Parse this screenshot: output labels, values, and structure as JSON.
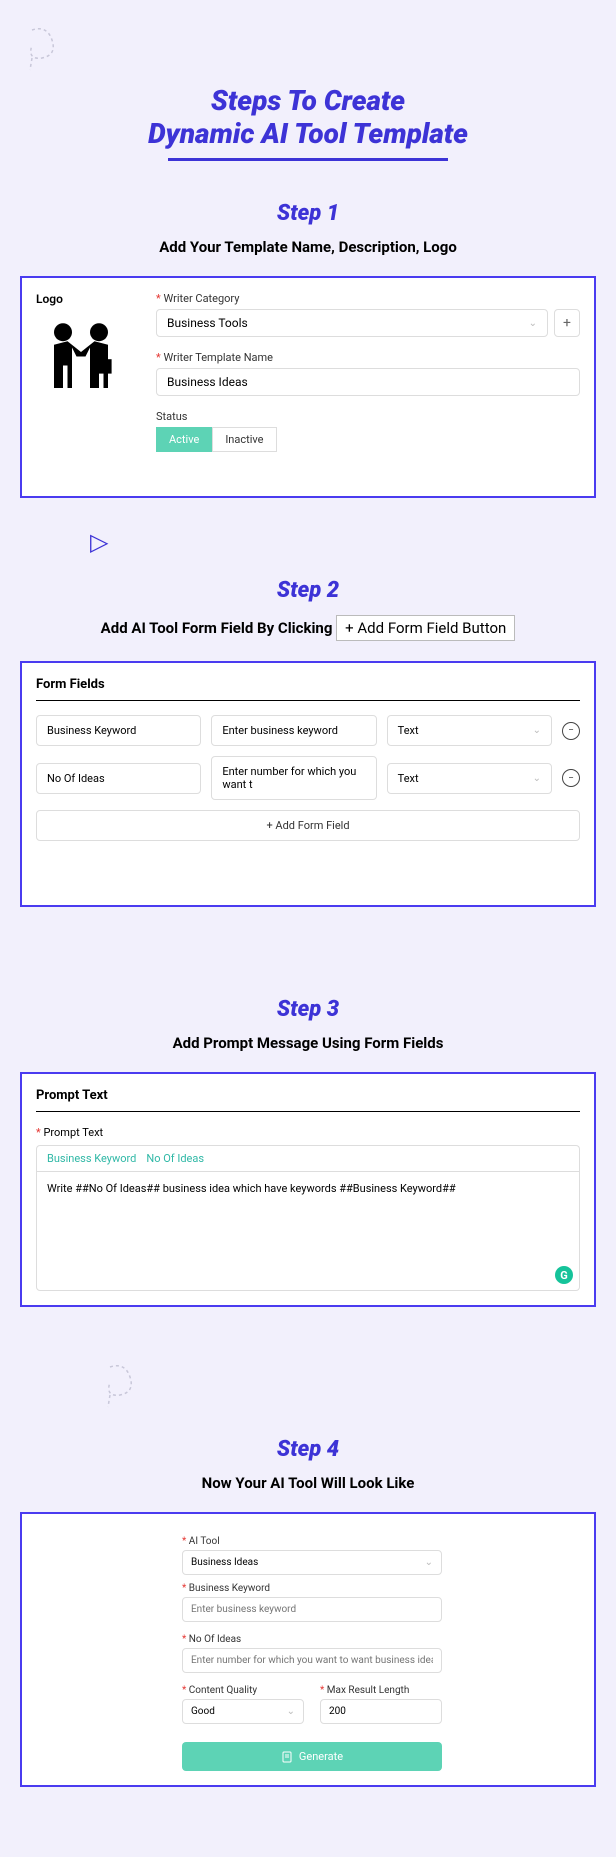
{
  "header": {
    "title_line1": "Steps To Create",
    "title_line2": "Dynamic AI Tool Template"
  },
  "step1": {
    "label": "Step 1",
    "desc": "Add Your Template Name, Description, Logo",
    "logo_label": "Logo",
    "category_label": "Writer Category",
    "category_value": "Business Tools",
    "name_label": "Writer Template Name",
    "name_value": "Business Ideas",
    "status_label": "Status",
    "status_active": "Active",
    "status_inactive": "Inactive"
  },
  "step2": {
    "label": "Step 2",
    "desc_pre": "Add AI Tool Form Field By Clicking ",
    "desc_btn": "+ Add Form Field Button",
    "section_header": "Form Fields",
    "rows": [
      {
        "name": "Business Keyword",
        "placeholder": "Enter business keyword",
        "type": "Text"
      },
      {
        "name": "No Of Ideas",
        "placeholder": "Enter number for which you want t",
        "type": "Text"
      }
    ],
    "add_btn": "+  Add Form Field"
  },
  "step3": {
    "label": "Step 3",
    "desc": "Add Prompt Message Using Form Fields",
    "section_header": "Prompt Text",
    "prompt_label": "Prompt Text",
    "tags": [
      "Business Keyword",
      "No Of Ideas"
    ],
    "prompt_value": "Write ##No Of Ideas## business idea which have keywords ##Business Keyword##"
  },
  "step4": {
    "label": "Step 4",
    "desc": "Now Your AI Tool Will Look Like",
    "tool_label": "AI Tool",
    "tool_value": "Business Ideas",
    "kw_label": "Business Keyword",
    "kw_placeholder": "Enter business keyword",
    "ideas_label": "No Of Ideas",
    "ideas_placeholder": "Enter number for which you want to want business idea",
    "quality_label": "Content Quality",
    "quality_value": "Good",
    "length_label": "Max Result Length",
    "length_value": "200",
    "generate": "Generate"
  }
}
